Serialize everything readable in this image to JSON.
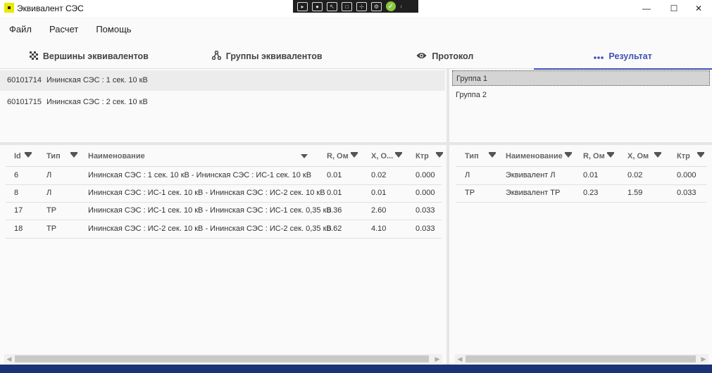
{
  "window": {
    "title": "Эквивалент СЭС",
    "minimize": "—",
    "maximize": "☐",
    "close": "✕"
  },
  "menu": [
    {
      "label": "Файл"
    },
    {
      "label": "Расчет"
    },
    {
      "label": "Помощь"
    }
  ],
  "tabs": [
    {
      "label": "Вершины эквивалентов",
      "icon": "dots-grid-icon"
    },
    {
      "label": "Группы эквивалентов",
      "icon": "tree-nodes-icon"
    },
    {
      "label": "Протокол",
      "icon": "eye-icon"
    },
    {
      "label": "Результат",
      "icon": "ellipsis-icon",
      "active": true
    }
  ],
  "vertices": [
    {
      "id": "60101714",
      "name": "Ининская СЭС : 1 сек. 10 кВ"
    },
    {
      "id": "60101715",
      "name": "Ининская СЭС : 2 сек. 10 кВ"
    }
  ],
  "groups": [
    {
      "label": "Группа 1"
    },
    {
      "label": "Группа 2"
    }
  ],
  "branches_table": {
    "headers": {
      "id": "Id",
      "type": "Тип",
      "name": "Наименование",
      "r": "R, Ом",
      "x": "X, О...",
      "ktr": "Ктр"
    },
    "rows": [
      {
        "id": "6",
        "type": "Л",
        "name": "Ининская СЭС : 1 сек. 10 кВ - Ининская СЭС : ИС-1 сек. 10 кВ",
        "r": "0.01",
        "x": "0.02",
        "ktr": "0.000"
      },
      {
        "id": "8",
        "type": "Л",
        "name": "Ининская СЭС : ИС-1 сек. 10 кВ - Ининская СЭС : ИС-2 сек. 10 кВ",
        "r": "0.01",
        "x": "0.01",
        "ktr": "0.000"
      },
      {
        "id": "17",
        "type": "ТР",
        "name": "Ининская СЭС : ИС-1 сек. 10 кВ - Ининская СЭС : ИС-1 сек. 0,35 кВ",
        "r": "0.36",
        "x": "2.60",
        "ktr": "0.033"
      },
      {
        "id": "18",
        "type": "ТР",
        "name": "Ининская СЭС : ИС-2 сек. 10 кВ - Ининская СЭС : ИС-2 сек. 0,35 кВ",
        "r": "0.62",
        "x": "4.10",
        "ktr": "0.033"
      }
    ]
  },
  "result_table": {
    "headers": {
      "type": "Тип",
      "name": "Наименование",
      "r": "R, Ом",
      "x": "X, Ом",
      "ktr": "Ктр"
    },
    "rows": [
      {
        "type": "Л",
        "name": "Эквивалент Л",
        "r": "0.01",
        "x": "0.02",
        "ktr": "0.000"
      },
      {
        "type": "ТР",
        "name": "Эквивалент ТР",
        "r": "0.23",
        "x": "1.59",
        "ktr": "0.033"
      }
    ]
  },
  "colors": {
    "accent": "#3f51b5",
    "taskbar": "#1a3276"
  }
}
